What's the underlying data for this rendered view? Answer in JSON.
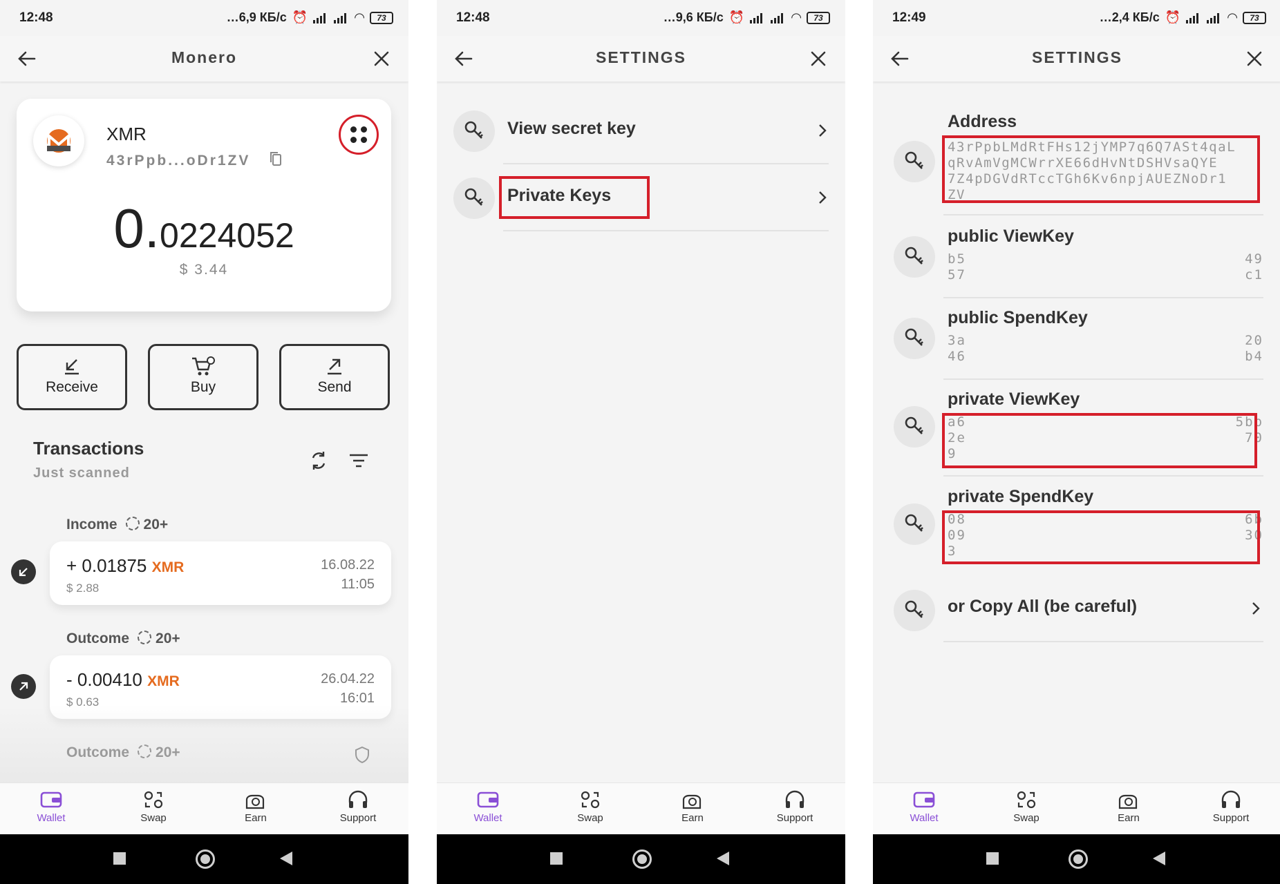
{
  "screens": [
    {
      "status": {
        "time": "12:48",
        "speed": "6,9 КБ/с",
        "battery": "73"
      },
      "header": {
        "title": "Monero"
      },
      "wallet": {
        "coin": "XMR",
        "address_short": "43rPpb...oDr1ZV",
        "balance_int": "0.",
        "balance_frac": "0224052",
        "balance_usd": "$ 3.44"
      },
      "actions": {
        "receive": "Receive",
        "buy": "Buy",
        "send": "Send"
      },
      "transactions": {
        "title": "Transactions",
        "subtitle": "Just scanned",
        "groups": [
          {
            "label": "Income",
            "count": "20+",
            "amount": "+ 0.01875",
            "currency": "XMR",
            "usd": "$ 2.88",
            "date": "16.08.22",
            "time": "11:05"
          },
          {
            "label": "Outcome",
            "count": "20+",
            "amount": "- 0.00410",
            "currency": "XMR",
            "usd": "$ 0.63",
            "date": "26.04.22",
            "time": "16:01"
          },
          {
            "label": "Outcome",
            "count": "20+"
          }
        ]
      }
    },
    {
      "status": {
        "time": "12:48",
        "speed": "9,6 КБ/с",
        "battery": "73"
      },
      "header": {
        "title": "SETTINGS"
      },
      "items": [
        "View secret key",
        "Private Keys"
      ]
    },
    {
      "status": {
        "time": "12:49",
        "speed": "2,4 КБ/с",
        "battery": "73"
      },
      "header": {
        "title": "SETTINGS"
      },
      "address": {
        "title": "Address",
        "lines": [
          "43rPpbLMdRtFHs12jYMP7q6Q7ASt4qaL",
          "qRvAmVgMCWrrXE66dHvNtDSHVsaQYE",
          "7Z4pDGVdRTccTGh6Kv6npjAUEZNoDr1",
          "ZV"
        ]
      },
      "keys": [
        {
          "title": "public ViewKey",
          "l1": "b5",
          "r1": "49",
          "l2": "57",
          "r2": "c1"
        },
        {
          "title": "public SpendKey",
          "l1": "3a",
          "r1": "20",
          "l2": "46",
          "r2": "b4"
        },
        {
          "title": "private ViewKey",
          "l1": "a6",
          "r1": "5bb",
          "l2": "2e",
          "r2": "70",
          "l3": "9"
        },
        {
          "title": "private SpendKey",
          "l1": "08",
          "r1": "6b",
          "l2": "09",
          "r2": "30",
          "l3": "3"
        }
      ],
      "copy_all": "or Copy All (be careful)"
    }
  ],
  "nav": {
    "wallet": "Wallet",
    "swap": "Swap",
    "earn": "Earn",
    "support": "Support"
  },
  "colors": {
    "accent": "#8a4fd6",
    "highlight": "#d51f2a",
    "monero": "#e56b1f"
  }
}
